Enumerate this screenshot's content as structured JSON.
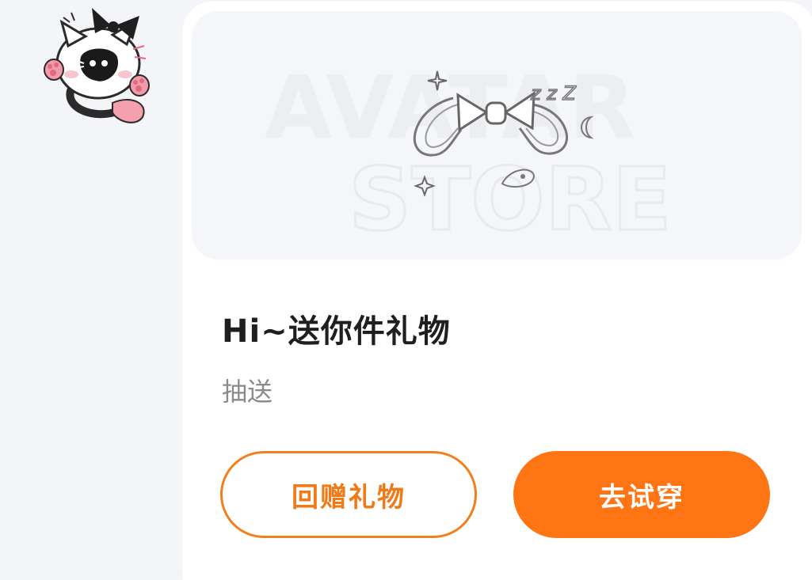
{
  "colors": {
    "accent": "#ff7413",
    "accent_outline": "#f07f1c",
    "title": "#1f1f1f",
    "subtitle": "#8a8a8a",
    "background": "#f3f5f8",
    "card": "#ffffff"
  },
  "avatar": {
    "icon": "cat-sticker-avatar"
  },
  "gift_card": {
    "banner": {
      "watermark_line1": "AVATAR",
      "watermark_line2": "STORE",
      "zzz": "z z Z",
      "illustration": "bow-clip-accessory"
    },
    "title": "Hi~送你件礼物",
    "subtitle": "抽送",
    "buttons": {
      "return_gift": "回赠礼物",
      "try_on": "去试穿"
    }
  }
}
